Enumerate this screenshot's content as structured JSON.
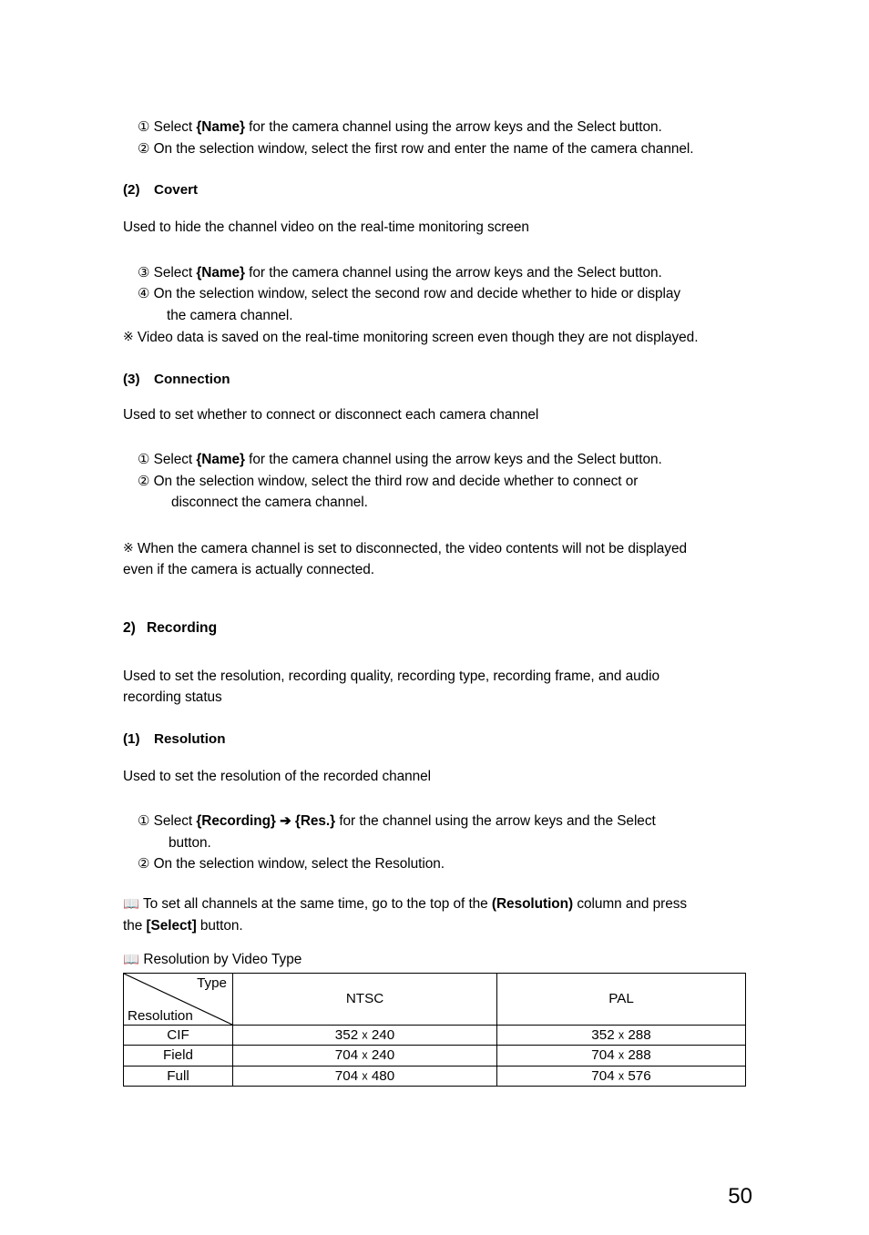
{
  "page": {
    "number": "50"
  },
  "symbols": {
    "circle_1": "①",
    "circle_2": "②",
    "circle_3": "③",
    "circle_4": "④",
    "reference_mark": "※",
    "book": "📖",
    "arrow_right": "➔",
    "multiply": "x"
  },
  "blocks": {
    "name_steps": {
      "step1_prefix": "Select ",
      "step1_bold": "{Name}",
      "step1_suffix": " for the camera channel using the arrow keys and the Select button.",
      "step2": "On the selection window, select the first row and enter the name of the camera channel."
    },
    "covert": {
      "heading_num": "(2)",
      "heading_text": "Covert",
      "description": "Used to hide the channel video on the real-time monitoring screen",
      "step3_prefix": "Select ",
      "step3_bold": "{Name}",
      "step3_suffix": " for the camera channel using the arrow keys and the Select button.",
      "step4_line1": "On the selection window, select the second row and decide whether to hide or display",
      "step4_line2": "the camera channel.",
      "note": "Video data is saved on the real-time monitoring screen even though they are not displayed."
    },
    "connection": {
      "heading_num": "(3)",
      "heading_text": "Connection",
      "description": "Used to set whether to connect or disconnect each camera channel",
      "step1_prefix": "Select ",
      "step1_bold": "{Name}",
      "step1_suffix": " for the camera channel using the arrow keys and the Select button.",
      "step2_line1": "On the selection window, select the third row and decide whether to connect or",
      "step2_line2": "disconnect the camera channel.",
      "note_line1": "When the camera channel is set to disconnected, the video contents will not be displayed",
      "note_line2": "even if the camera is actually connected."
    },
    "recording": {
      "heading_num": "2)",
      "heading_text": "Recording",
      "description_line1": "Used to set the resolution, recording quality, recording type, recording frame, and audio",
      "description_line2": "recording status"
    },
    "resolution": {
      "heading_num": "(1)",
      "heading_text": "Resolution",
      "description": "Used to set the resolution of the recorded channel",
      "step1_prefix": "Select ",
      "step1_bold1": "{Recording}",
      "step1_bold2": "{Res.}",
      "step1_suffix": " for the channel using the arrow keys and the Select",
      "step1_line2": "button.",
      "step2": "On the selection window, select the Resolution.",
      "tip_prefix": "To set all channels at the same time, go to the top of the ",
      "tip_bold1": "(Resolution)",
      "tip_mid": " column and press",
      "tip_line2_prefix": "the ",
      "tip_bold2": "[Select]",
      "tip_line2_suffix": " button."
    }
  },
  "table": {
    "caption": "Resolution by Video Type",
    "corner_top_label": "Type",
    "corner_bottom_label": "Resolution",
    "columns": [
      "NTSC",
      "PAL"
    ],
    "rows": [
      {
        "label": "CIF",
        "ntsc_w": "352",
        "ntsc_h": "240",
        "pal_w": "352",
        "pal_h": "288"
      },
      {
        "label": "Field",
        "ntsc_w": "704",
        "ntsc_h": "240",
        "pal_w": "704",
        "pal_h": "288"
      },
      {
        "label": "Full",
        "ntsc_w": "704",
        "ntsc_h": "480",
        "pal_w": "704",
        "pal_h": "576"
      }
    ]
  }
}
